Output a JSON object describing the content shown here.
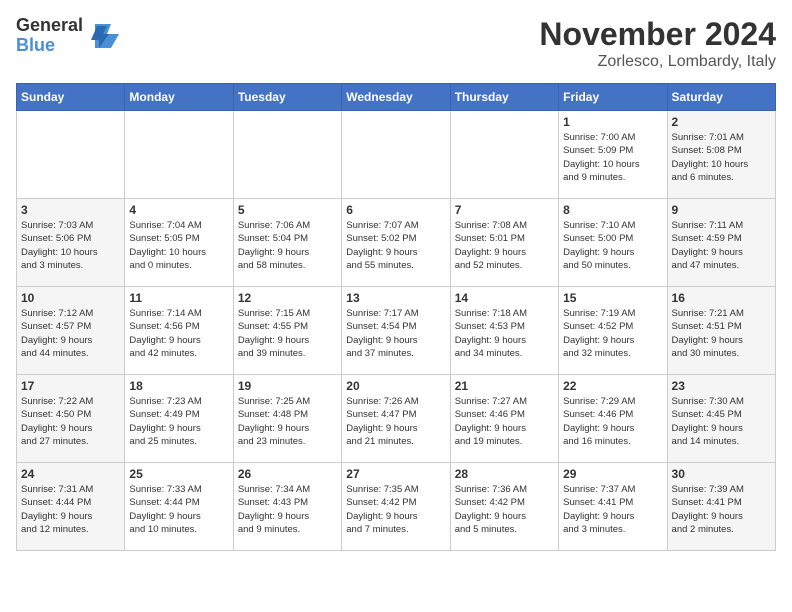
{
  "header": {
    "logo_line1": "General",
    "logo_line2": "Blue",
    "month": "November 2024",
    "location": "Zorlesco, Lombardy, Italy"
  },
  "days_of_week": [
    "Sunday",
    "Monday",
    "Tuesday",
    "Wednesday",
    "Thursday",
    "Friday",
    "Saturday"
  ],
  "weeks": [
    [
      {
        "day": "",
        "info": "",
        "type": "empty"
      },
      {
        "day": "",
        "info": "",
        "type": "empty"
      },
      {
        "day": "",
        "info": "",
        "type": "empty"
      },
      {
        "day": "",
        "info": "",
        "type": "empty"
      },
      {
        "day": "",
        "info": "",
        "type": "empty"
      },
      {
        "day": "1",
        "info": "Sunrise: 7:00 AM\nSunset: 5:09 PM\nDaylight: 10 hours\nand 9 minutes.",
        "type": "weekend"
      },
      {
        "day": "2",
        "info": "Sunrise: 7:01 AM\nSunset: 5:08 PM\nDaylight: 10 hours\nand 6 minutes.",
        "type": "weekend"
      }
    ],
    [
      {
        "day": "3",
        "info": "Sunrise: 7:03 AM\nSunset: 5:06 PM\nDaylight: 10 hours\nand 3 minutes.",
        "type": "weekend"
      },
      {
        "day": "4",
        "info": "Sunrise: 7:04 AM\nSunset: 5:05 PM\nDaylight: 10 hours\nand 0 minutes.",
        "type": "weekday"
      },
      {
        "day": "5",
        "info": "Sunrise: 7:06 AM\nSunset: 5:04 PM\nDaylight: 9 hours\nand 58 minutes.",
        "type": "weekday"
      },
      {
        "day": "6",
        "info": "Sunrise: 7:07 AM\nSunset: 5:02 PM\nDaylight: 9 hours\nand 55 minutes.",
        "type": "weekday"
      },
      {
        "day": "7",
        "info": "Sunrise: 7:08 AM\nSunset: 5:01 PM\nDaylight: 9 hours\nand 52 minutes.",
        "type": "weekday"
      },
      {
        "day": "8",
        "info": "Sunrise: 7:10 AM\nSunset: 5:00 PM\nDaylight: 9 hours\nand 50 minutes.",
        "type": "weekend"
      },
      {
        "day": "9",
        "info": "Sunrise: 7:11 AM\nSunset: 4:59 PM\nDaylight: 9 hours\nand 47 minutes.",
        "type": "weekend"
      }
    ],
    [
      {
        "day": "10",
        "info": "Sunrise: 7:12 AM\nSunset: 4:57 PM\nDaylight: 9 hours\nand 44 minutes.",
        "type": "weekend"
      },
      {
        "day": "11",
        "info": "Sunrise: 7:14 AM\nSunset: 4:56 PM\nDaylight: 9 hours\nand 42 minutes.",
        "type": "weekday"
      },
      {
        "day": "12",
        "info": "Sunrise: 7:15 AM\nSunset: 4:55 PM\nDaylight: 9 hours\nand 39 minutes.",
        "type": "weekday"
      },
      {
        "day": "13",
        "info": "Sunrise: 7:17 AM\nSunset: 4:54 PM\nDaylight: 9 hours\nand 37 minutes.",
        "type": "weekday"
      },
      {
        "day": "14",
        "info": "Sunrise: 7:18 AM\nSunset: 4:53 PM\nDaylight: 9 hours\nand 34 minutes.",
        "type": "weekday"
      },
      {
        "day": "15",
        "info": "Sunrise: 7:19 AM\nSunset: 4:52 PM\nDaylight: 9 hours\nand 32 minutes.",
        "type": "weekend"
      },
      {
        "day": "16",
        "info": "Sunrise: 7:21 AM\nSunset: 4:51 PM\nDaylight: 9 hours\nand 30 minutes.",
        "type": "weekend"
      }
    ],
    [
      {
        "day": "17",
        "info": "Sunrise: 7:22 AM\nSunset: 4:50 PM\nDaylight: 9 hours\nand 27 minutes.",
        "type": "weekend"
      },
      {
        "day": "18",
        "info": "Sunrise: 7:23 AM\nSunset: 4:49 PM\nDaylight: 9 hours\nand 25 minutes.",
        "type": "weekday"
      },
      {
        "day": "19",
        "info": "Sunrise: 7:25 AM\nSunset: 4:48 PM\nDaylight: 9 hours\nand 23 minutes.",
        "type": "weekday"
      },
      {
        "day": "20",
        "info": "Sunrise: 7:26 AM\nSunset: 4:47 PM\nDaylight: 9 hours\nand 21 minutes.",
        "type": "weekday"
      },
      {
        "day": "21",
        "info": "Sunrise: 7:27 AM\nSunset: 4:46 PM\nDaylight: 9 hours\nand 19 minutes.",
        "type": "weekday"
      },
      {
        "day": "22",
        "info": "Sunrise: 7:29 AM\nSunset: 4:46 PM\nDaylight: 9 hours\nand 16 minutes.",
        "type": "weekend"
      },
      {
        "day": "23",
        "info": "Sunrise: 7:30 AM\nSunset: 4:45 PM\nDaylight: 9 hours\nand 14 minutes.",
        "type": "weekend"
      }
    ],
    [
      {
        "day": "24",
        "info": "Sunrise: 7:31 AM\nSunset: 4:44 PM\nDaylight: 9 hours\nand 12 minutes.",
        "type": "weekend"
      },
      {
        "day": "25",
        "info": "Sunrise: 7:33 AM\nSunset: 4:44 PM\nDaylight: 9 hours\nand 10 minutes.",
        "type": "weekday"
      },
      {
        "day": "26",
        "info": "Sunrise: 7:34 AM\nSunset: 4:43 PM\nDaylight: 9 hours\nand 9 minutes.",
        "type": "weekday"
      },
      {
        "day": "27",
        "info": "Sunrise: 7:35 AM\nSunset: 4:42 PM\nDaylight: 9 hours\nand 7 minutes.",
        "type": "weekday"
      },
      {
        "day": "28",
        "info": "Sunrise: 7:36 AM\nSunset: 4:42 PM\nDaylight: 9 hours\nand 5 minutes.",
        "type": "weekday"
      },
      {
        "day": "29",
        "info": "Sunrise: 7:37 AM\nSunset: 4:41 PM\nDaylight: 9 hours\nand 3 minutes.",
        "type": "weekend"
      },
      {
        "day": "30",
        "info": "Sunrise: 7:39 AM\nSunset: 4:41 PM\nDaylight: 9 hours\nand 2 minutes.",
        "type": "weekend"
      }
    ]
  ]
}
